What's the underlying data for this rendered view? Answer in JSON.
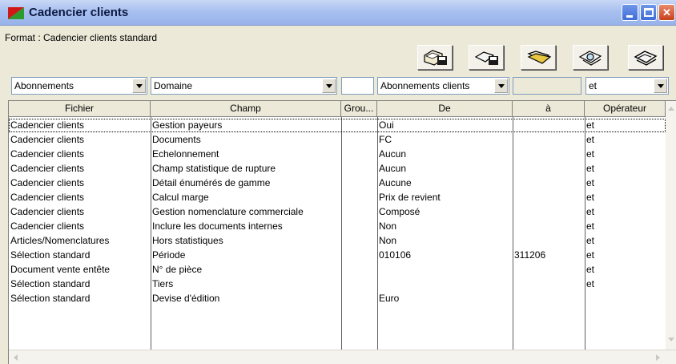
{
  "window": {
    "title": "Cadencier clients"
  },
  "format": {
    "label": "Format : Cadencier clients standard"
  },
  "toolbar": {
    "buttons": [
      {
        "icon": "save-disk-icon"
      },
      {
        "icon": "save-as-disk-icon"
      },
      {
        "icon": "open-folder-icon"
      },
      {
        "icon": "print-preview-icon"
      },
      {
        "icon": "print-icon"
      }
    ]
  },
  "filters": {
    "fichier": "Abonnements",
    "champ": "Domaine",
    "de": "Abonnements clients",
    "operateur": "et"
  },
  "grid": {
    "headers": [
      "Fichier",
      "Champ",
      "Grou...",
      "De",
      "à",
      "Opérateur"
    ],
    "rows": [
      [
        "Cadencier clients",
        "Gestion payeurs",
        "",
        "Oui",
        "",
        "et"
      ],
      [
        "Cadencier clients",
        "Documents",
        "",
        "FC",
        "",
        "et"
      ],
      [
        "Cadencier clients",
        "Echelonnement",
        "",
        "Aucun",
        "",
        "et"
      ],
      [
        "Cadencier clients",
        "Champ statistique de rupture",
        "",
        "Aucun",
        "",
        "et"
      ],
      [
        "Cadencier clients",
        "Détail énumérés de gamme",
        "",
        "Aucune",
        "",
        "et"
      ],
      [
        "Cadencier clients",
        "Calcul marge",
        "",
        "Prix de revient",
        "",
        "et"
      ],
      [
        "Cadencier clients",
        "Gestion nomenclature commerciale",
        "",
        "Composé",
        "",
        "et"
      ],
      [
        "Cadencier clients",
        "Inclure les documents internes",
        "",
        "Non",
        "",
        "et"
      ],
      [
        "Articles/Nomenclatures",
        "Hors statistiques",
        "",
        "Non",
        "",
        "et"
      ],
      [
        "Sélection standard",
        "Période",
        "",
        "010106",
        "311206",
        "et"
      ],
      [
        "Document vente entête",
        "N° de pièce",
        "",
        "",
        "",
        "et"
      ],
      [
        "Sélection standard",
        "Tiers",
        "",
        "",
        "",
        "et"
      ],
      [
        "Sélection standard",
        "Devise d'édition",
        "",
        "Euro",
        "",
        ""
      ]
    ]
  }
}
